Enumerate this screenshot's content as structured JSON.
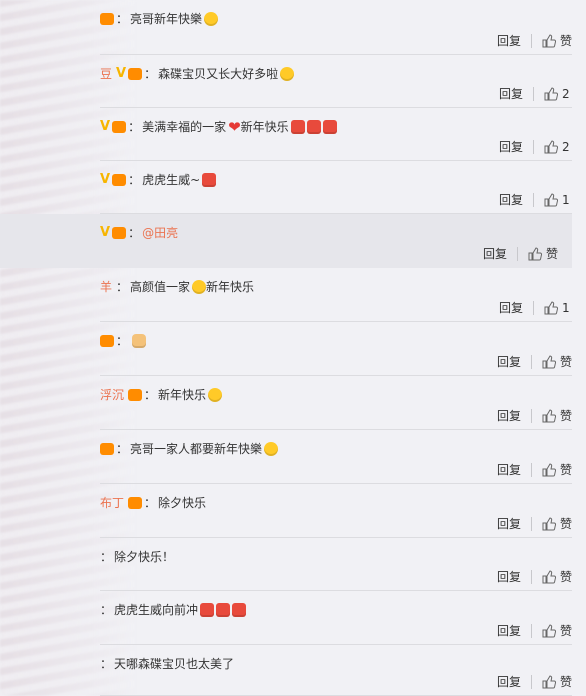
{
  "colors": {
    "username": "#eb7350",
    "vip": "#f7b500",
    "text": "#333333",
    "background": "#f1f1f5"
  },
  "comments": [
    {
      "username": "",
      "has_vip": false,
      "badge": "icon-badge",
      "text": "亮哥新年快樂",
      "emojis": [
        "smile-emoji"
      ],
      "mention": "",
      "reply": "回复",
      "like": "赞",
      "likes": ""
    },
    {
      "username": "豆",
      "has_vip": true,
      "badge": "icon-badge",
      "text": "森碟宝贝又长大好多啦",
      "emojis": [
        "kiss-emoji"
      ],
      "mention": "",
      "reply": "回复",
      "like": "",
      "likes": "2"
    },
    {
      "username": "",
      "has_vip": true,
      "badge": "icon-badge",
      "text": "美满幸福的一家",
      "emojis": [
        "heart-emoji",
        "fu-emoji",
        "fu-emoji",
        "fu-emoji"
      ],
      "mention": "",
      "text2": "新年快乐",
      "reply": "回复",
      "like": "",
      "likes": "2"
    },
    {
      "username": "",
      "has_vip": true,
      "badge": "icon-badge",
      "text": "虎虎生威~",
      "emojis": [
        "fu-emoji"
      ],
      "mention": "",
      "reply": "回复",
      "like": "",
      "likes": "1"
    },
    {
      "username": "",
      "has_vip": true,
      "badge": "icon-badge",
      "text": "",
      "emojis": [],
      "mention": "@田亮",
      "reply": "回复",
      "like": "赞",
      "likes": ""
    },
    {
      "username": "羊",
      "has_vip": false,
      "badge": "",
      "text": "高颜值一家",
      "emojis": [
        "kiss-emoji"
      ],
      "mention": "",
      "text2": "新年快乐",
      "reply": "回复",
      "like": "",
      "likes": "1"
    },
    {
      "username": "",
      "has_vip": false,
      "badge": "icon-badge",
      "text": "",
      "emojis": [
        "thumb-emoji"
      ],
      "mention": "",
      "reply": "回复",
      "like": "赞",
      "likes": ""
    },
    {
      "username": "浮沉",
      "has_vip": false,
      "badge": "icon-badge",
      "text": "新年快乐",
      "emojis": [
        "laugh-emoji"
      ],
      "mention": "",
      "reply": "回复",
      "like": "赞",
      "likes": ""
    },
    {
      "username": "",
      "has_vip": false,
      "badge": "icon-badge",
      "text": "亮哥一家人都要新年快樂",
      "emojis": [
        "smile-emoji"
      ],
      "mention": "",
      "reply": "回复",
      "like": "赞",
      "likes": ""
    },
    {
      "username": "布丁",
      "has_vip": false,
      "badge": "icon-badge",
      "text": "除夕快乐",
      "emojis": [],
      "mention": "",
      "reply": "回复",
      "like": "赞",
      "likes": ""
    },
    {
      "username": "",
      "has_vip": false,
      "badge": "",
      "text": "除夕快乐！",
      "emojis": [],
      "mention": "",
      "reply": "回复",
      "like": "赞",
      "likes": ""
    },
    {
      "username": "",
      "has_vip": false,
      "badge": "",
      "text": "虎虎生威向前冲",
      "emojis": [
        "fu-emoji",
        "fu-emoji",
        "fu-emoji"
      ],
      "mention": "",
      "reply": "回复",
      "like": "赞",
      "likes": ""
    },
    {
      "username": "",
      "has_vip": false,
      "badge": "",
      "text": "天哪森碟宝贝也太美了",
      "emojis": [],
      "mention": "",
      "reply": "回复",
      "like": "赞",
      "likes": ""
    }
  ]
}
